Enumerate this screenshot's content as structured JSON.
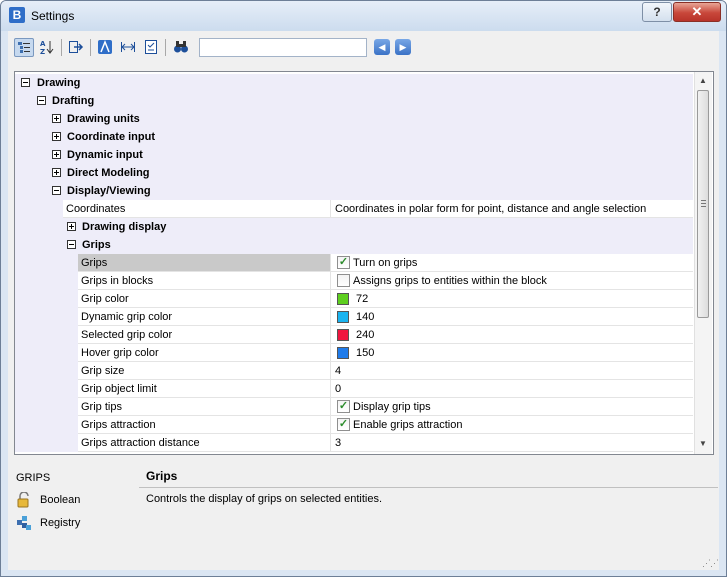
{
  "window": {
    "title": "Settings"
  },
  "titlebar": {
    "help_label": "?",
    "close_label": "✕"
  },
  "toolbar": {
    "search": {
      "value": ""
    },
    "nav_back_label": "◀",
    "nav_forward_label": "▶"
  },
  "tree": {
    "groups": {
      "drawing": "Drawing",
      "drafting": "Drafting",
      "drawing_units": "Drawing units",
      "coordinate_input": "Coordinate input",
      "dynamic_input": "Dynamic input",
      "direct_modeling": "Direct Modeling",
      "display_viewing": "Display/Viewing",
      "drawing_display": "Drawing display",
      "grips": "Grips"
    },
    "coordinates": {
      "name": "Coordinates",
      "value": "Coordinates in polar form for point, distance and angle selection"
    },
    "grip_settings": [
      {
        "name": "Grips",
        "value": "Turn on grips",
        "kind": "checkbox",
        "checked": true
      },
      {
        "name": "Grips in blocks",
        "value": "Assigns grips to entities within the block",
        "kind": "checkbox",
        "checked": false
      },
      {
        "name": "Grip color",
        "value": "72",
        "kind": "color",
        "color": "#5ecf1f"
      },
      {
        "name": "Dynamic grip color",
        "value": "140",
        "kind": "color",
        "color": "#1ab4f0"
      },
      {
        "name": "Selected grip color",
        "value": "240",
        "kind": "color",
        "color": "#f0163f"
      },
      {
        "name": "Hover grip color",
        "value": "150",
        "kind": "color",
        "color": "#1f7bea"
      },
      {
        "name": "Grip size",
        "value": "4",
        "kind": "text"
      },
      {
        "name": "Grip object limit",
        "value": "0",
        "kind": "text"
      },
      {
        "name": "Grip tips",
        "value": "Display grip tips",
        "kind": "checkbox",
        "checked": true
      },
      {
        "name": "Grips attraction",
        "value": "Enable grips attraction",
        "kind": "checkbox",
        "checked": true
      },
      {
        "name": "Grips attraction distance",
        "value": "3",
        "kind": "text"
      }
    ]
  },
  "info": {
    "variable": "GRIPS",
    "type_label": "Boolean",
    "storage_label": "Registry",
    "title": "Grips",
    "description": "Controls the display of grips on selected entities."
  }
}
